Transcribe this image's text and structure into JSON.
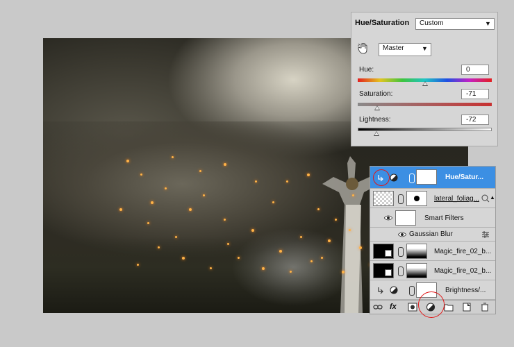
{
  "properties_panel": {
    "title": "Hue/Saturation",
    "preset": "Custom",
    "channel": "Master",
    "hue": {
      "label": "Hue:",
      "value": "0",
      "level": 0.5
    },
    "saturation": {
      "label": "Saturation:",
      "value": "-71",
      "level": 0.145
    },
    "lightness": {
      "label": "Lightness:",
      "value": "-72",
      "level": 0.14
    },
    "icons": {
      "hand": "targeted-adjustment-hand-icon",
      "dropdown": "chevron-down-icon"
    }
  },
  "layers_panel": {
    "layers": [
      {
        "name": "Hue/Satur...",
        "selected": true
      },
      {
        "name": "lateral_foliag..."
      },
      {
        "name": "Smart Filters"
      },
      {
        "name": "Gaussian Blur"
      },
      {
        "name": "Magic_fire_02_b..."
      },
      {
        "name": "Magic_fire_02_b..."
      },
      {
        "name": "Brightness/..."
      }
    ],
    "bottom_icons": [
      "link-layers-icon",
      "fx-icon",
      "add-mask-icon",
      "adjustment-layer-icon",
      "new-group-icon",
      "new-layer-icon",
      "trash-icon"
    ],
    "fx_label": "fx"
  },
  "colors": {
    "selection": "#3c8fe3",
    "highlight_circle": "#e01818",
    "panel_bg": "#d6d6d6"
  }
}
